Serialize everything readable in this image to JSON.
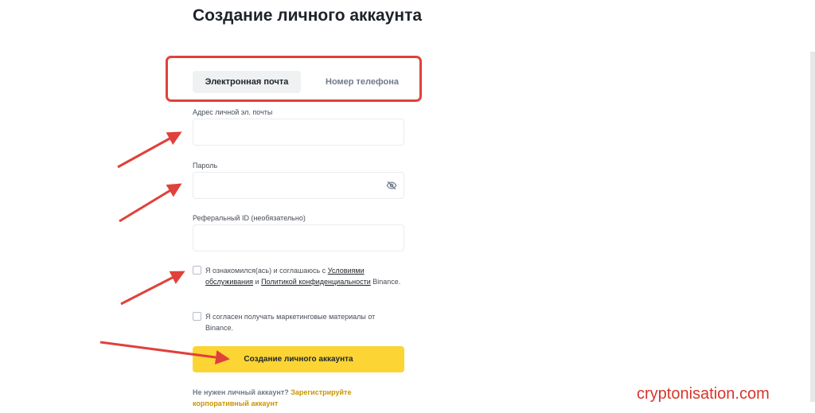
{
  "page": {
    "title": "Создание личного аккаунта"
  },
  "tabs": [
    {
      "label": "Электронная почта",
      "active": true
    },
    {
      "label": "Номер телефона",
      "active": false
    }
  ],
  "fields": {
    "email": {
      "label": "Адрес личной эл. почты",
      "value": ""
    },
    "password": {
      "label": "Пароль",
      "value": "",
      "icon": "eye-off-icon"
    },
    "referral": {
      "label": "Реферальный ID (необязательно)",
      "value": ""
    }
  },
  "terms": {
    "prefix": "Я ознакомился(ась) и соглашаюсь с ",
    "link1": "Условиями обслуживания",
    "middle": " и ",
    "link2": "Политикой конфиденциальности",
    "suffix": " Binance.",
    "checked": false
  },
  "marketing": {
    "text": "Я согласен получать маркетинговые материалы от Binance.",
    "checked": false
  },
  "submit_label": "Создание личного аккаунта",
  "footer": {
    "prefix": "Не нужен личный аккаунт? ",
    "link": "Зарегистрируйте корпоративный аккаунт"
  },
  "watermark": "cryptonisation.com",
  "colors": {
    "accent": "#fcd535",
    "highlight": "#e0413b",
    "link": "#c99400",
    "watermark": "#d8342c"
  }
}
